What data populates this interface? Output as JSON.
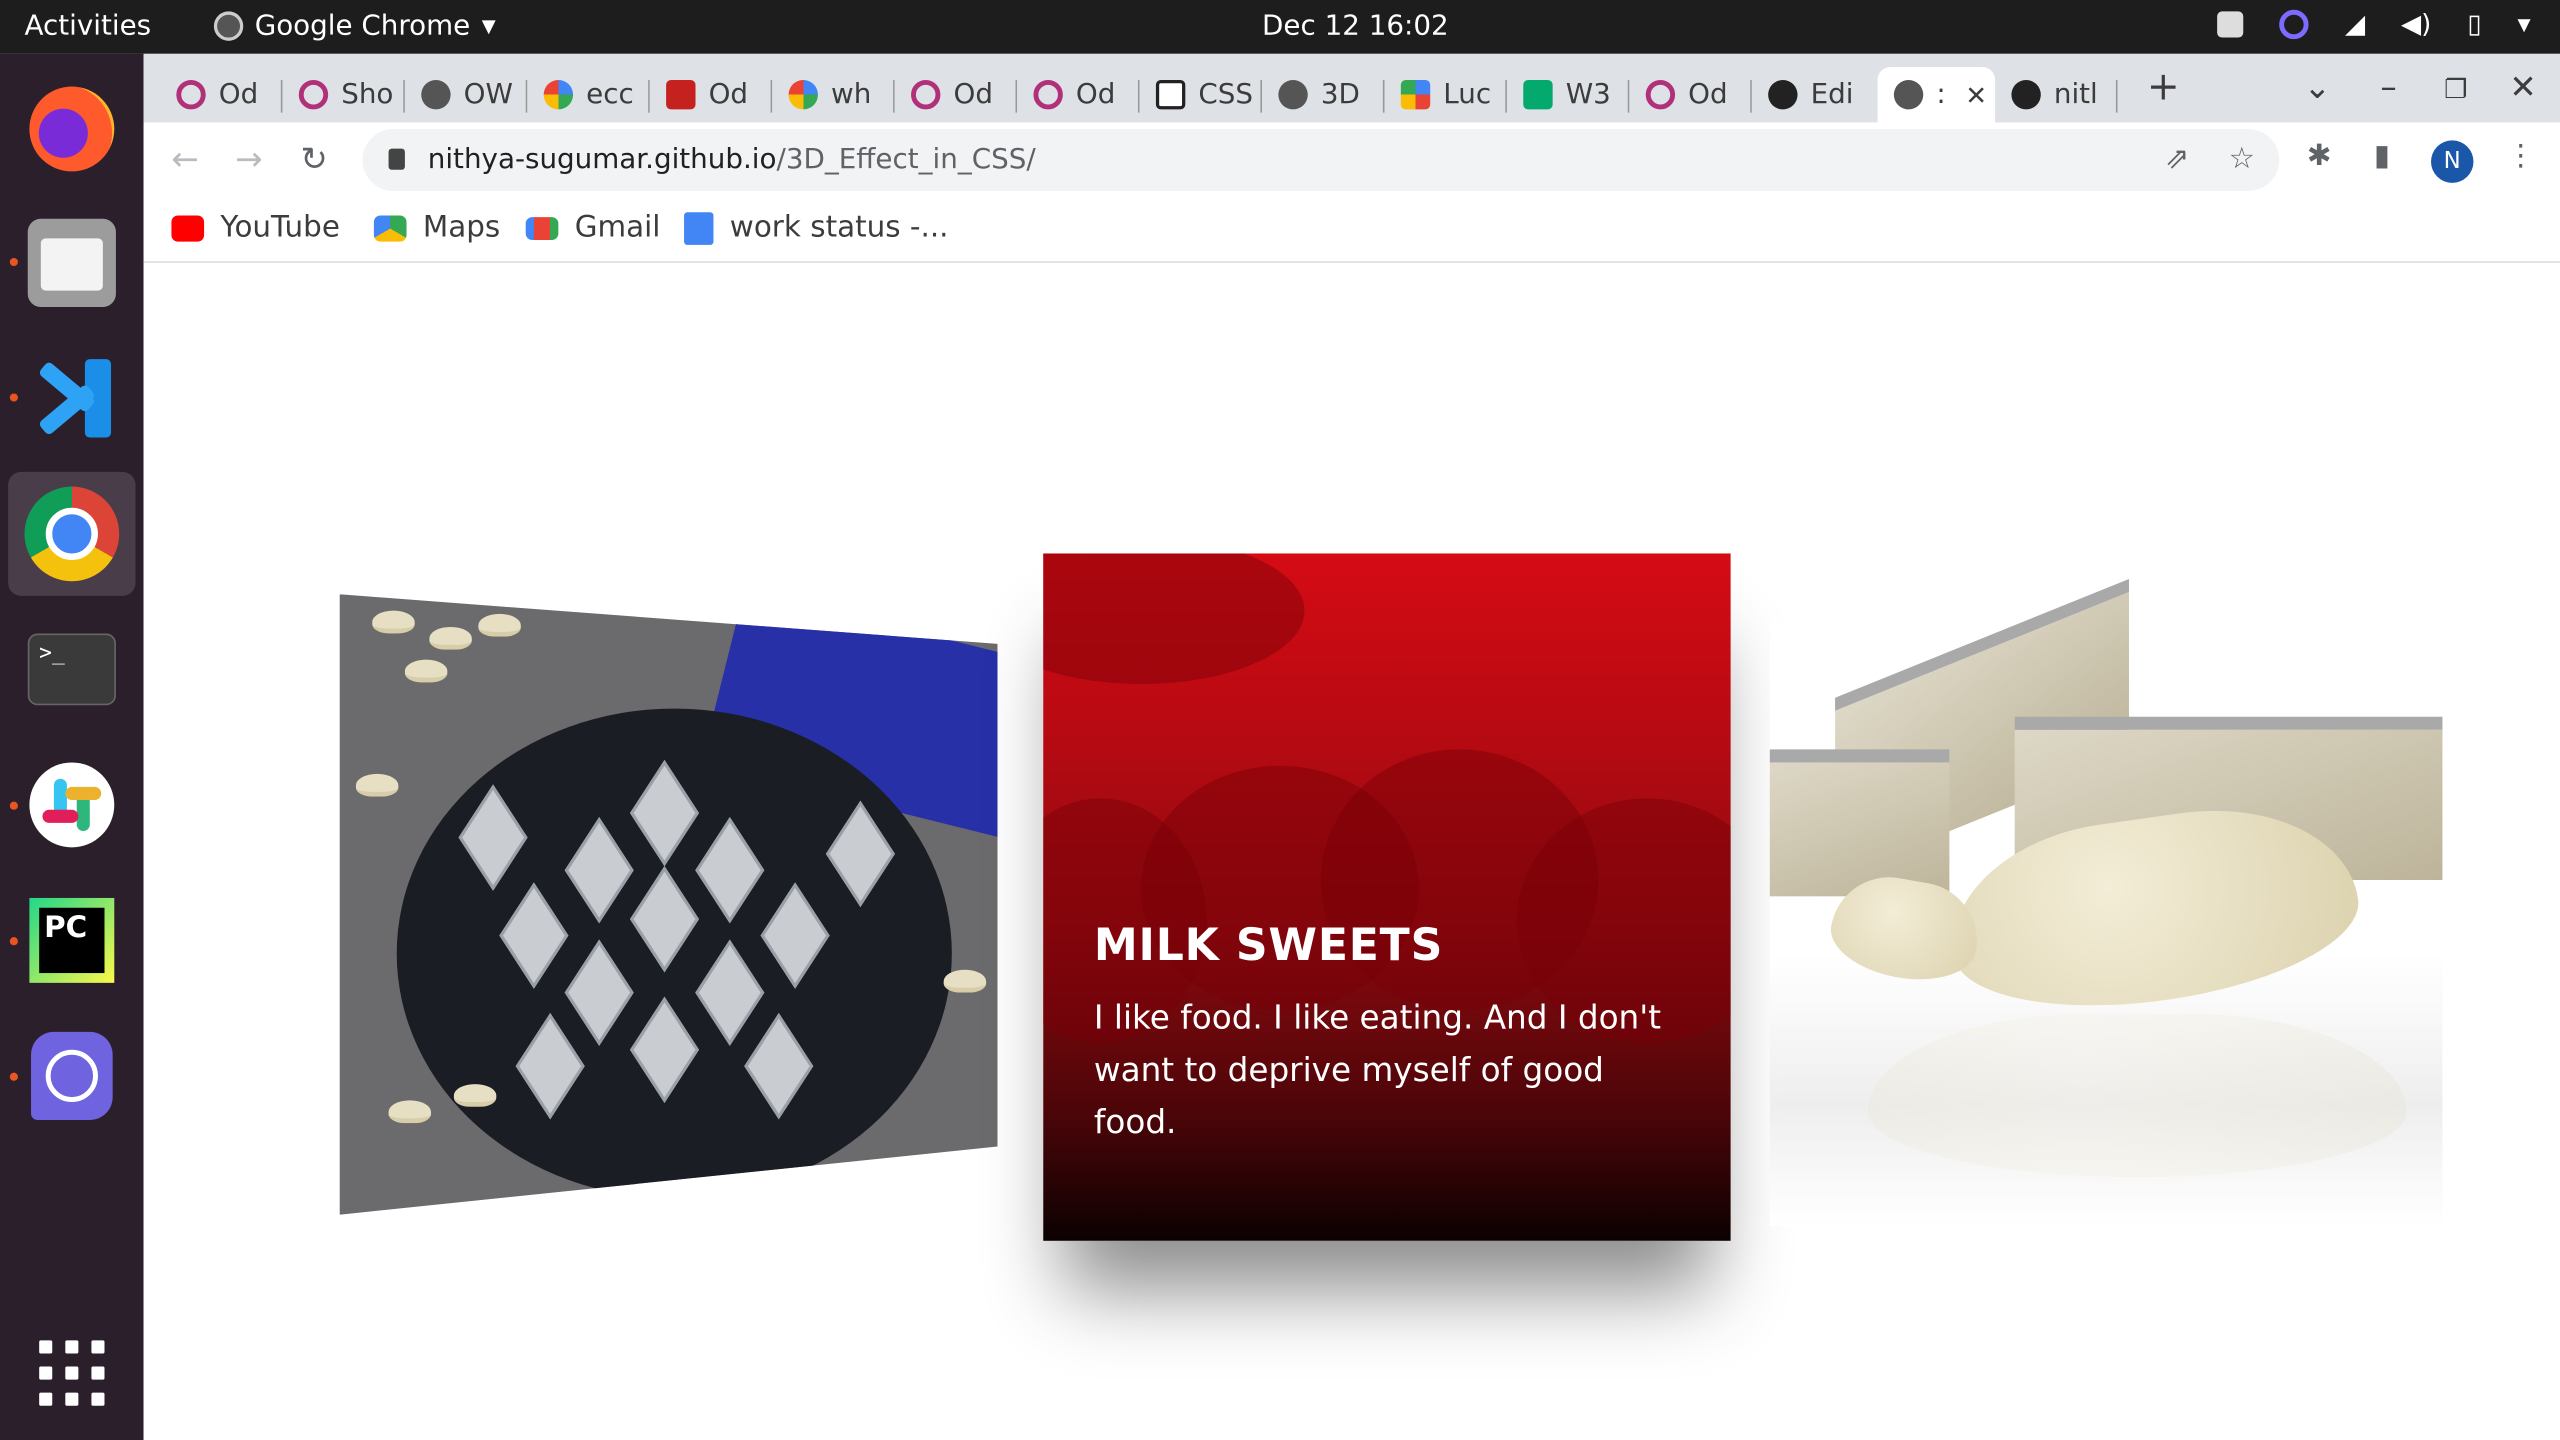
{
  "system_bar": {
    "activities": "Activities",
    "app_name": "Google Chrome",
    "clock": "Dec 12  16:02"
  },
  "dock": {
    "apps": [
      "firefox-icon",
      "files-icon",
      "vscode-icon",
      "chrome-icon",
      "terminal-icon",
      "slack-icon",
      "pycharm-icon",
      "clock-app-icon",
      "app-grid-icon"
    ],
    "terminal_glyph": ">_",
    "pycharm_glyph": "PC"
  },
  "tabs": [
    {
      "label": "Od",
      "icon": "odin"
    },
    {
      "label": "Sho",
      "icon": "odin"
    },
    {
      "label": "OW",
      "icon": "globe"
    },
    {
      "label": "ecc",
      "icon": "g"
    },
    {
      "label": "Od",
      "icon": "red"
    },
    {
      "label": "wh",
      "icon": "g"
    },
    {
      "label": "Od",
      "icon": "odin"
    },
    {
      "label": "Od",
      "icon": "odin"
    },
    {
      "label": "CSS",
      "icon": "cp"
    },
    {
      "label": "3D",
      "icon": "globe"
    },
    {
      "label": "Luc",
      "icon": "pin"
    },
    {
      "label": "W3",
      "icon": "w3"
    },
    {
      "label": "Od",
      "icon": "odin"
    },
    {
      "label": "Edi",
      "icon": "gh"
    },
    {
      "label": ":",
      "icon": "globe",
      "active": true
    },
    {
      "label": "nitl",
      "icon": "gh"
    }
  ],
  "tab_controls": {
    "new_tab": "+",
    "tab_search": "⌄",
    "minimize": "–",
    "restore": "❐",
    "close": "✕",
    "tab_close": "✕"
  },
  "toolbar": {
    "back": "←",
    "forward": "→",
    "reload": "↻",
    "url_host": "nithya-sugumar.github.io",
    "url_path": "/3D_Effect_in_CSS/",
    "share": "⇗",
    "star": "☆",
    "extensions": "✱",
    "sidepanel": "▮",
    "profile_initial": "N",
    "menu": "⋮"
  },
  "bookmarks": [
    {
      "label": "YouTube",
      "color": "#ff0000"
    },
    {
      "label": "Maps",
      "color": "#34a853"
    },
    {
      "label": "Gmail",
      "color": "#ea4335"
    },
    {
      "label": "work status -...",
      "color": "#4285f4"
    }
  ],
  "page": {
    "center_card": {
      "title": "MILK SWEETS",
      "description": "I like food. I like eating. And I don't want to deprive myself of good food."
    },
    "colors": {
      "accent_red": "#d50b14",
      "card_dark": "#0c0101"
    }
  }
}
